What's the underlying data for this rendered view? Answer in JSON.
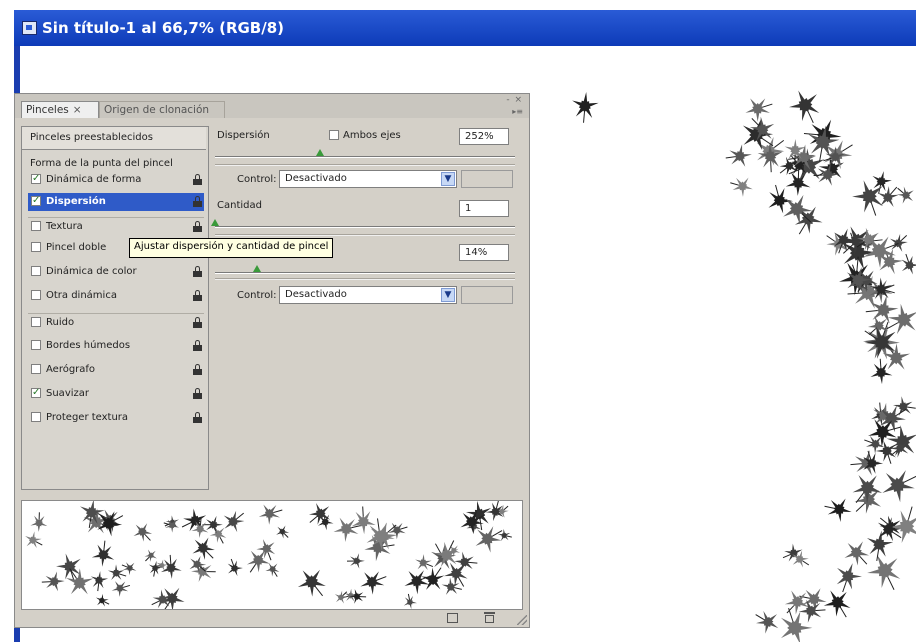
{
  "document": {
    "title": "Sin título-1 al 66,7% (RGB/8)"
  },
  "panel": {
    "tabs": [
      {
        "label": "Pinceles",
        "close": "×"
      },
      {
        "label": "Origen de clonación"
      }
    ],
    "window_controls": "- ×",
    "menu_glyph": "▸≡",
    "presets_label": "Pinceles preestablecidos",
    "tip_shape_label": "Forma de la punta del pincel",
    "items": [
      {
        "label": "Dinámica de forma",
        "checked": true,
        "selected": false
      },
      {
        "label": "Dispersión",
        "checked": true,
        "selected": true
      },
      {
        "label": "Textura",
        "checked": false,
        "selected": false
      },
      {
        "label": "Pincel doble",
        "checked": false,
        "selected": false
      },
      {
        "label": "Dinámica de color",
        "checked": false,
        "selected": false
      },
      {
        "label": "Otra dinámica",
        "checked": false,
        "selected": false
      },
      {
        "label": "Ruido",
        "checked": false,
        "selected": false
      },
      {
        "label": "Bordes húmedos",
        "checked": false,
        "selected": false
      },
      {
        "label": "Aerógrafo",
        "checked": false,
        "selected": false
      },
      {
        "label": "Suavizar",
        "checked": true,
        "selected": false
      },
      {
        "label": "Proteger textura",
        "checked": false,
        "selected": false
      }
    ],
    "scatter": {
      "label": "Dispersión",
      "both_axes_label": "Ambos ejes",
      "both_axes_checked": false,
      "value": "252%",
      "slider_level": 0.35
    },
    "control1": {
      "label": "Control:",
      "value": "Desactivado"
    },
    "count": {
      "label": "Cantidad",
      "value": "1",
      "slider_level": 0.0
    },
    "count_jitter": {
      "value": "14%",
      "slider_level": 0.14
    },
    "control2": {
      "label": "Control:",
      "value": "Desactivado"
    },
    "tooltip": "Ajustar dispersión y cantidad de pincel"
  },
  "colors": {
    "title_bar": "#1e4ccf",
    "panel_bg": "#d4d0c8",
    "selection": "#2f5bc8",
    "slider_thumb": "#3a9a3a",
    "tooltip_bg": "#ffffe1"
  },
  "icons": [
    "lock-icon",
    "checkbox-icon",
    "dropdown-arrow-icon",
    "new-brush-icon",
    "trash-icon",
    "document-icon"
  ]
}
